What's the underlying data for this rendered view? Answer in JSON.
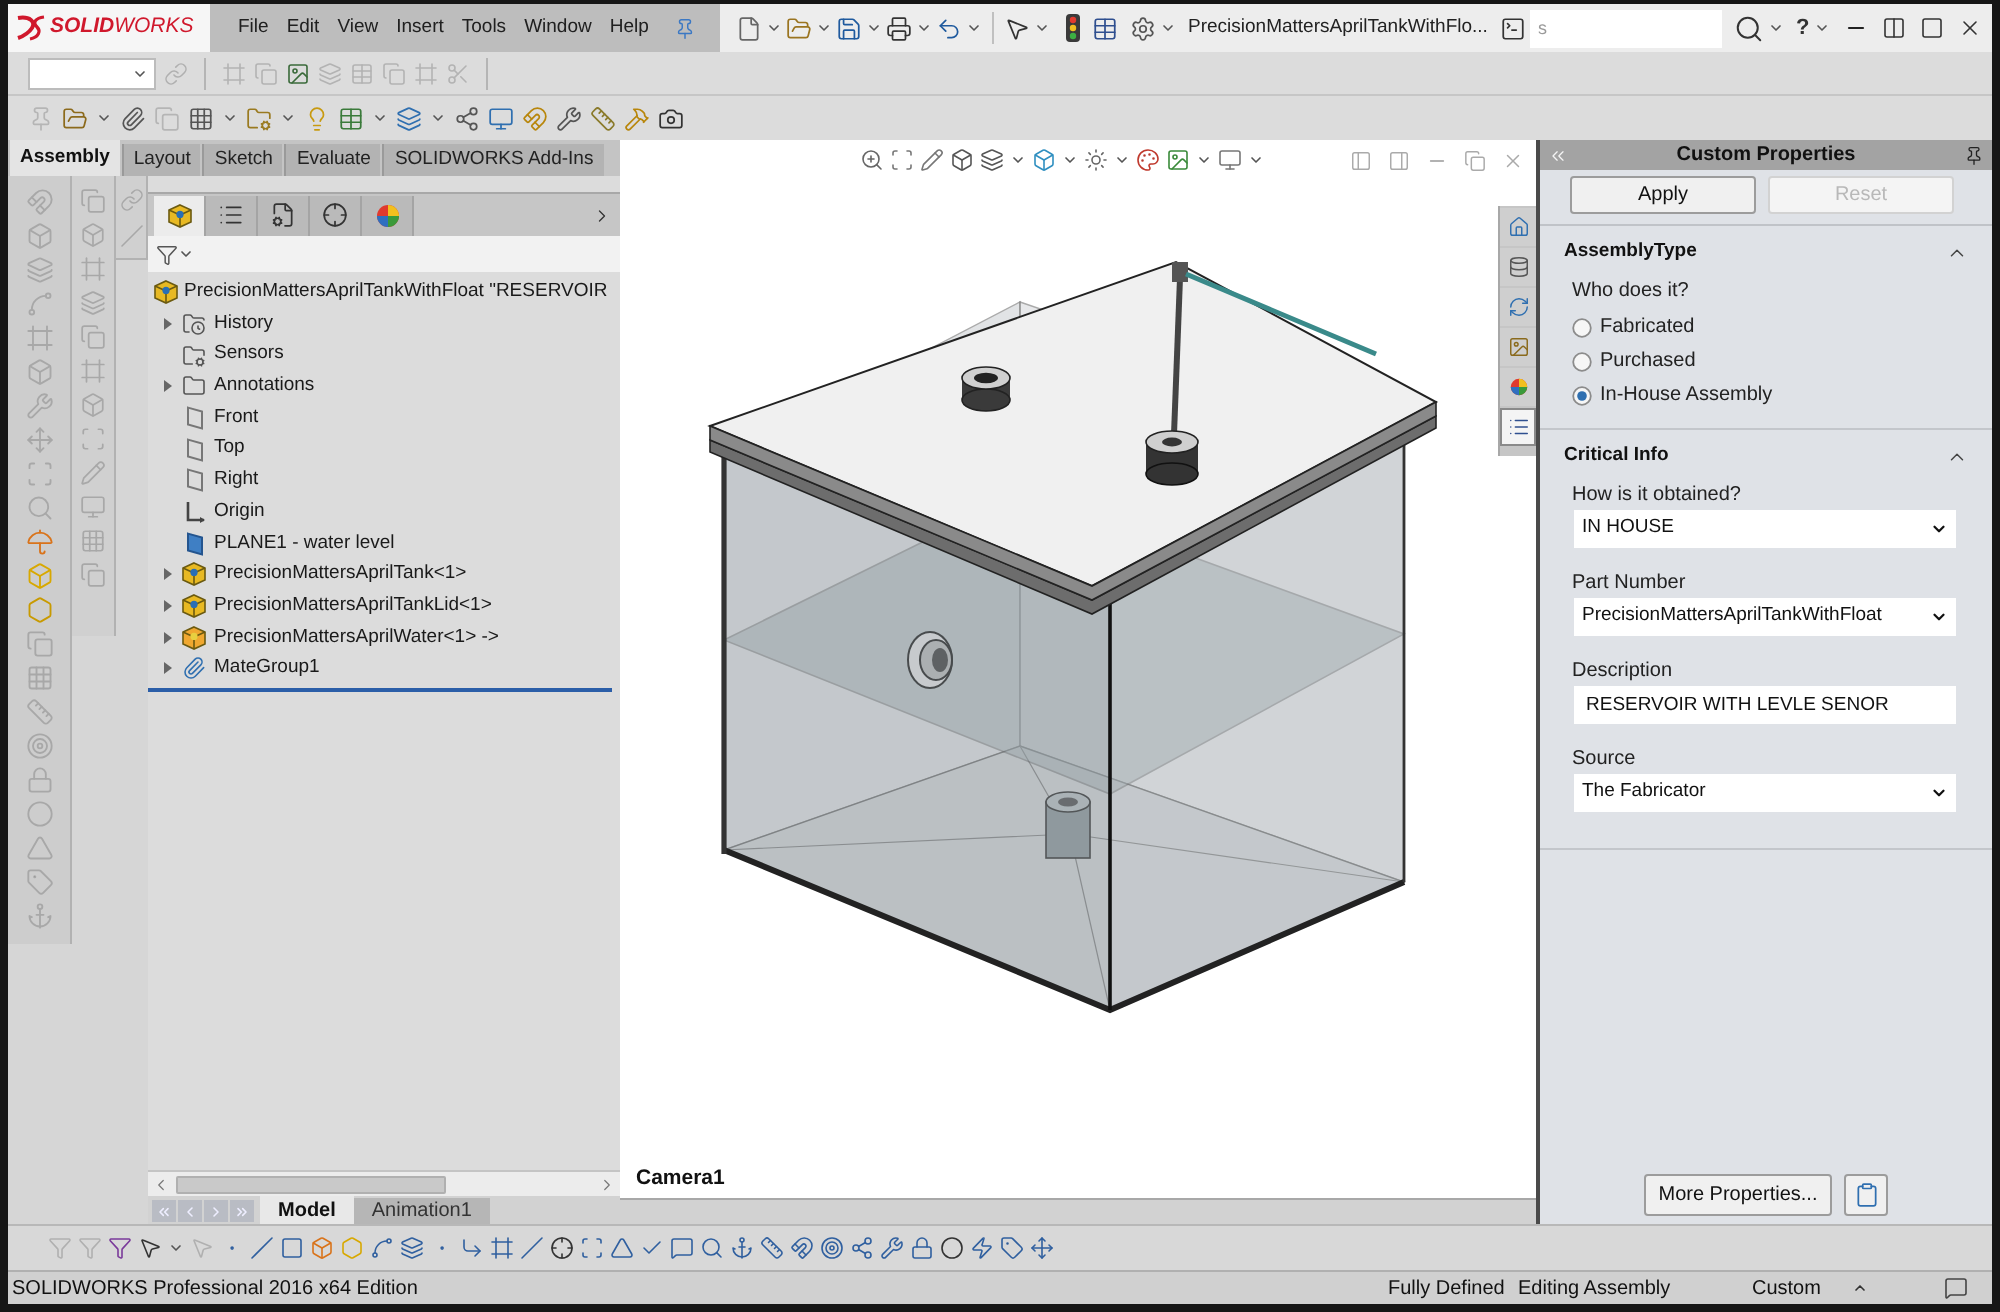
{
  "title_bar": {
    "logo_text": "**SOLID**WORKS",
    "menu": [
      "File",
      "Edit",
      "View",
      "Insert",
      "Tools",
      "Window",
      "Help"
    ],
    "document_title": "PrecisionMattersAprilTankWithFlo...",
    "command_search": {
      "placeholder": "s"
    },
    "help": "?"
  },
  "command_tabs": [
    {
      "label": "Assembly",
      "selected": true
    },
    {
      "label": "Layout",
      "selected": false
    },
    {
      "label": "Sketch",
      "selected": false
    },
    {
      "label": "Evaluate",
      "selected": false
    },
    {
      "label": "SOLIDWORKS Add-Ins",
      "selected": false
    }
  ],
  "feature_manager": {
    "panel_tabs": [
      {
        "kind": "feature-tree",
        "selected": true
      },
      {
        "kind": "property-manager",
        "selected": false
      },
      {
        "kind": "configuration-manager",
        "selected": false
      },
      {
        "kind": "dimxpert",
        "selected": false
      },
      {
        "kind": "display-manager",
        "selected": false
      }
    ],
    "tree": {
      "label": "PrecisionMattersAprilTankWithFloat \"RESERVOIR",
      "kind": "assembly",
      "children": [
        {
          "label": "History",
          "kind": "history",
          "expandable": true
        },
        {
          "label": "Sensors",
          "kind": "sensors",
          "expandable": false
        },
        {
          "label": "Annotations",
          "kind": "annotations",
          "expandable": true
        },
        {
          "label": "Front",
          "kind": "plane",
          "expandable": false
        },
        {
          "label": "Top",
          "kind": "plane",
          "expandable": false
        },
        {
          "label": "Right",
          "kind": "plane",
          "expandable": false
        },
        {
          "label": "Origin",
          "kind": "origin",
          "expandable": false
        },
        {
          "label": "PLANE1 - water level",
          "kind": "reference-plane",
          "expandable": false
        },
        {
          "label": "PrecisionMattersAprilTank<1>",
          "kind": "part",
          "expandable": true
        },
        {
          "label": "PrecisionMattersAprilTankLid<1>",
          "kind": "part",
          "expandable": true
        },
        {
          "label": "PrecisionMattersAprilWater<1> ->",
          "kind": "part-external",
          "expandable": true
        },
        {
          "label": "MateGroup1",
          "kind": "mate-group",
          "expandable": true
        }
      ]
    },
    "bottom_tabs": [
      {
        "label": "Model",
        "selected": true
      },
      {
        "label": "Animation1",
        "selected": false
      }
    ]
  },
  "viewport": {
    "camera_label": "Camera1",
    "task_pane_tabs": [
      {
        "kind": "home",
        "selected": false
      },
      {
        "kind": "design-library",
        "selected": false
      },
      {
        "kind": "file-explorer",
        "selected": false
      },
      {
        "kind": "view-palette",
        "selected": false
      },
      {
        "kind": "appearances",
        "selected": false
      },
      {
        "kind": "custom-properties",
        "selected": true
      }
    ]
  },
  "custom_properties": {
    "title": "Custom Properties",
    "buttons": [
      {
        "label": "Apply",
        "disabled": false
      },
      {
        "label": "Reset",
        "disabled": true
      }
    ],
    "sections": [
      {
        "kind": "radio-group",
        "title": "AssemblyType",
        "expanded": true,
        "question": "Who does it?",
        "options": [
          {
            "label": "Fabricated",
            "selected": false
          },
          {
            "label": "Purchased",
            "selected": false
          },
          {
            "label": "In-House Assembly",
            "selected": true
          }
        ]
      },
      {
        "kind": "fields",
        "title": "Critical Info",
        "expanded": true,
        "fields": [
          {
            "label": "How is it obtained?",
            "kind": "dropdown",
            "value": "IN HOUSE"
          },
          {
            "label": "Part Number",
            "kind": "dropdown",
            "value": "PrecisionMattersAprilTankWithFloat"
          },
          {
            "label": "Description",
            "kind": "text",
            "value": "RESERVOIR WITH LEVLE SENOR"
          },
          {
            "label": "Source",
            "kind": "dropdown",
            "value": "The Fabricator"
          }
        ]
      }
    ],
    "more_button": "More Properties..."
  },
  "status_bar": {
    "edition": "SOLIDWORKS Professional 2016 x64 Edition",
    "fields": [
      "Fully Defined",
      "Editing Assembly",
      "Custom"
    ]
  }
}
